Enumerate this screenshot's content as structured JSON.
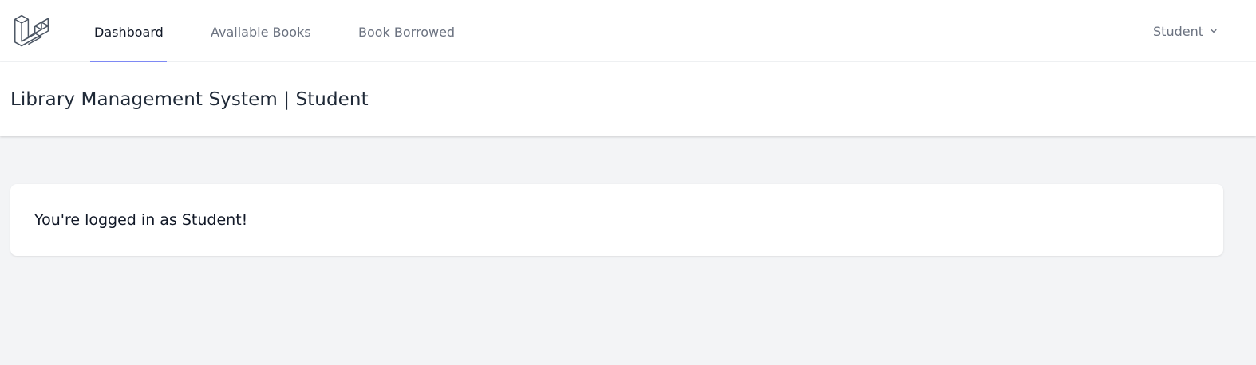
{
  "nav": {
    "logo_icon": "laravel-logo-icon",
    "links": [
      {
        "label": "Dashboard",
        "active": true
      },
      {
        "label": "Available Books",
        "active": false
      },
      {
        "label": "Book Borrowed",
        "active": false
      }
    ],
    "user": {
      "label": "Student",
      "chevron_icon": "chevron-down-icon"
    }
  },
  "header": {
    "title": "Library Management System | Student"
  },
  "main": {
    "message": "You're logged in as Student!"
  },
  "colors": {
    "accent": "#818cf8",
    "background": "#f3f4f6",
    "text_primary": "#111827",
    "text_secondary": "#6b7280"
  }
}
